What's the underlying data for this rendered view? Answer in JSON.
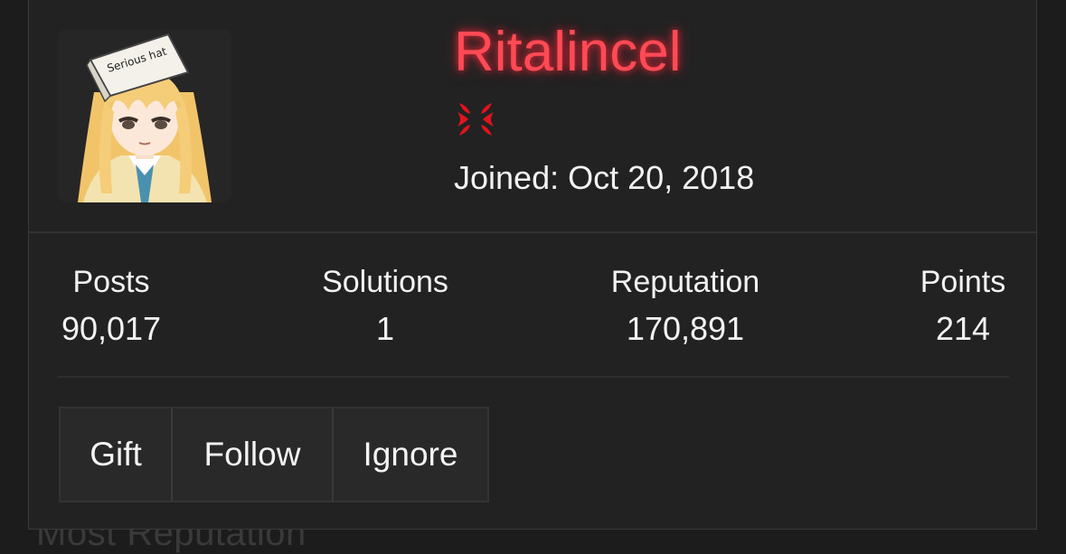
{
  "background": {
    "partial_heading": "Most Reputation"
  },
  "profile": {
    "username": "Ritalincel",
    "username_color": "#ff4a55",
    "badge_icon": "anger-symbol-icon",
    "joined": "Joined: Oct 20, 2018",
    "avatar": {
      "icon": "anime-girl-avatar",
      "hat_text": "Serious hat"
    }
  },
  "stats": [
    {
      "label": "Posts",
      "value": "90,017"
    },
    {
      "label": "Solutions",
      "value": "1"
    },
    {
      "label": "Reputation",
      "value": "170,891"
    },
    {
      "label": "Points",
      "value": "214"
    }
  ],
  "actions": {
    "gift_label": "Gift",
    "follow_label": "Follow",
    "ignore_label": "Ignore"
  }
}
